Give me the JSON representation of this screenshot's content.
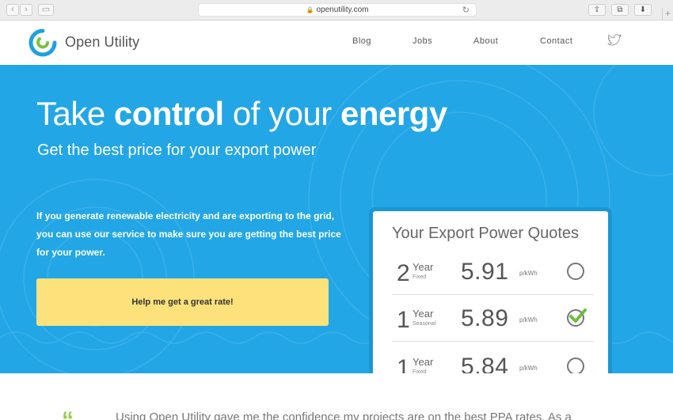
{
  "browser": {
    "url": "openutility.com",
    "back_icon": "chevron-left-icon",
    "forward_icon": "chevron-right-icon"
  },
  "header": {
    "brand": "Open Utility",
    "nav": [
      "Blog",
      "Jobs",
      "About",
      "Contact"
    ],
    "social_icon": "twitter-icon"
  },
  "hero": {
    "title_1": "Take ",
    "title_2": "control",
    "title_3": " of your ",
    "title_4": "energy",
    "subtitle": "Get the best price for your export power",
    "paragraph": "If you generate renewable electricity and are exporting to the grid, you can use our service to make sure you are getting the best price for your power.",
    "cta": "Help me get a great rate!"
  },
  "quotes": {
    "title": "Your Export Power Quotes",
    "rows": [
      {
        "num": "2",
        "year": "Year",
        "type": "Fixed",
        "rate": "5.91",
        "unit": "p/kWh",
        "selected": false
      },
      {
        "num": "1",
        "year": "Year",
        "type": "Seasonal",
        "rate": "5.89",
        "unit": "p/kWh",
        "selected": true
      },
      {
        "num": "1",
        "year": "Year",
        "type": "Fixed",
        "rate": "5.84",
        "unit": "p/kWh",
        "selected": false
      }
    ]
  },
  "testimonial": {
    "text": "Using Open Utility gave me the confidence my projects are on the best PPA rates. As a"
  },
  "colors": {
    "hero_bg": "#22a6e6",
    "cta_bg": "#fde27c",
    "card_border": "#1a96d2",
    "check_green": "#6cbf3e",
    "logo_blue": "#1ea1e0",
    "logo_green": "#7cc242"
  }
}
